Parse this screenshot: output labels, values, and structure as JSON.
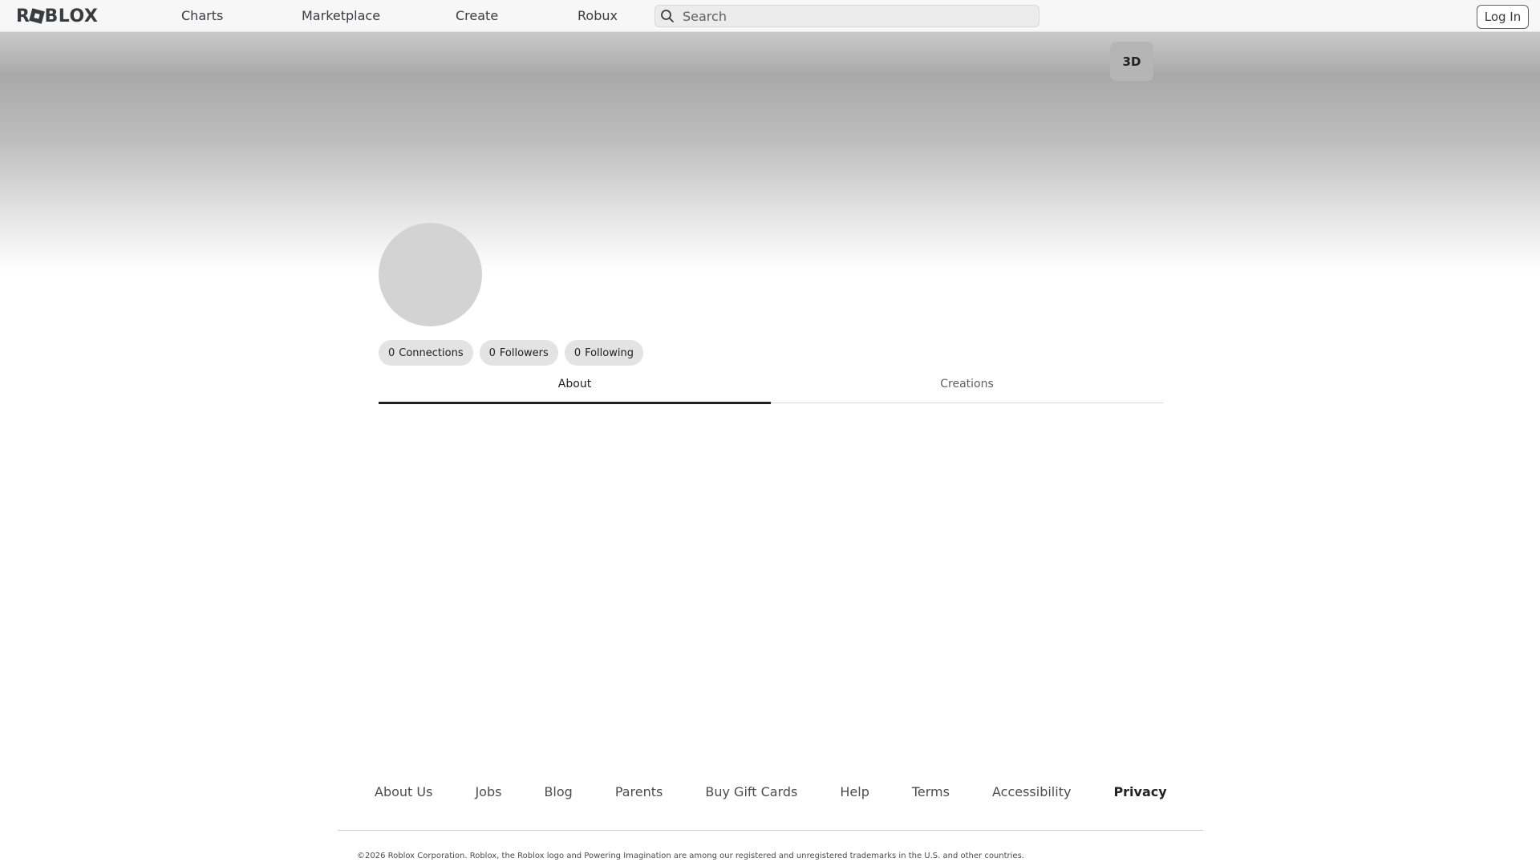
{
  "header": {
    "logo_text": "ROBLOX",
    "nav": [
      "Charts",
      "Marketplace",
      "Create",
      "Robux"
    ],
    "search_placeholder": "Search",
    "login_label": "Log In"
  },
  "banner": {
    "view_toggle_label": "3D"
  },
  "profile": {
    "stats": [
      {
        "count": "0",
        "label": "Connections"
      },
      {
        "count": "0",
        "label": "Followers"
      },
      {
        "count": "0",
        "label": "Following"
      }
    ],
    "tabs": [
      {
        "label": "About",
        "active": true
      },
      {
        "label": "Creations",
        "active": false
      }
    ]
  },
  "footer": {
    "links": [
      "About Us",
      "Jobs",
      "Blog",
      "Parents",
      "Buy Gift Cards",
      "Help",
      "Terms",
      "Accessibility",
      "Privacy"
    ],
    "copyright": "©2026 Roblox Corporation. Roblox, the Roblox logo and Powering Imagination are among our registered and unregistered trademarks in the U.S. and other countries."
  },
  "colors": {
    "header_bg": "#f7f7f8",
    "text": "#393b3d",
    "pill_bg": "#e3e3e4",
    "avatar_placeholder": "#d3d3d4"
  },
  "icons": {
    "search": "search-icon",
    "logo": "roblox-logo"
  }
}
